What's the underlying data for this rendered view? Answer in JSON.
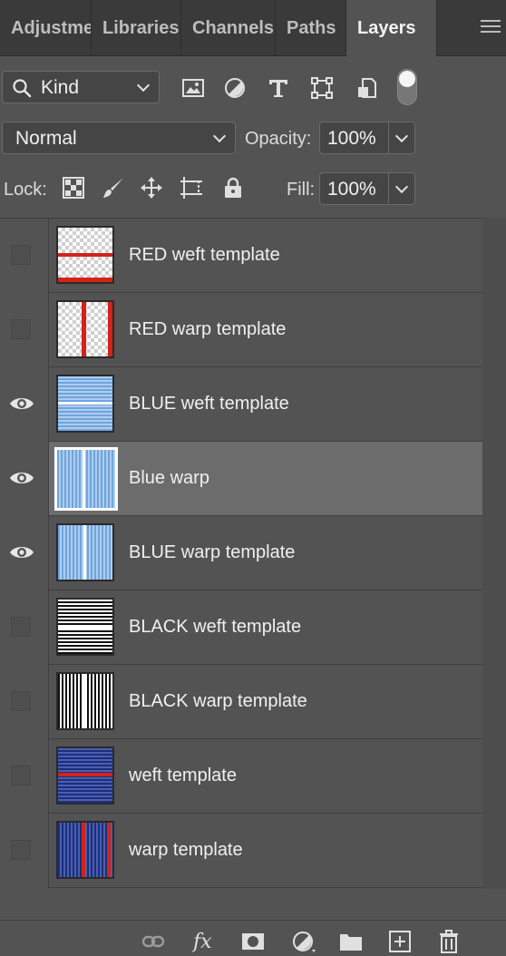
{
  "tabs": [
    {
      "label": "Adjustments",
      "active": false
    },
    {
      "label": "Libraries",
      "active": false
    },
    {
      "label": "Channels",
      "active": false
    },
    {
      "label": "Paths",
      "active": false
    },
    {
      "label": "Layers",
      "active": true
    }
  ],
  "filter": {
    "kind_label": "Kind",
    "icons": [
      "pixel-layer-filter-icon",
      "adjustment-layer-filter-icon",
      "type-layer-filter-icon",
      "shape-layer-filter-icon",
      "smart-object-filter-icon"
    ],
    "filter_toggle_on": false
  },
  "blend": {
    "mode": "Normal",
    "opacity_label": "Opacity:",
    "opacity_value": "100%"
  },
  "lock": {
    "label": "Lock:",
    "icons": [
      "lock-transparent-pixels-icon",
      "lock-image-pixels-icon",
      "lock-position-icon",
      "lock-artboard-icon",
      "lock-all-icon"
    ],
    "fill_label": "Fill:",
    "fill_value": "100%"
  },
  "layers": [
    {
      "name": "RED weft template",
      "visible": false,
      "thumb": "red-weft",
      "selected": false
    },
    {
      "name": "RED warp template",
      "visible": false,
      "thumb": "red-warp",
      "selected": false
    },
    {
      "name": "BLUE weft template",
      "visible": true,
      "thumb": "blue-weft",
      "selected": false
    },
    {
      "name": "Blue warp",
      "visible": true,
      "thumb": "blue-warp",
      "selected": true
    },
    {
      "name": "BLUE warp template",
      "visible": true,
      "thumb": "blue-warp",
      "selected": false
    },
    {
      "name": "BLACK weft template",
      "visible": false,
      "thumb": "black-weft",
      "selected": false
    },
    {
      "name": "BLACK warp template",
      "visible": false,
      "thumb": "black-warp",
      "selected": false
    },
    {
      "name": "weft template",
      "visible": false,
      "thumb": "navy-weft",
      "selected": false
    },
    {
      "name": "warp template",
      "visible": false,
      "thumb": "navy-warp",
      "selected": false
    }
  ],
  "bottom_icons": [
    "link-layers-icon",
    "fx-icon",
    "add-mask-icon",
    "new-adjustment-layer-icon",
    "new-group-icon",
    "new-layer-icon",
    "delete-layer-icon"
  ],
  "colors": {
    "panel": "#535353",
    "tabbar": "#3a3a3a",
    "selected_row": "#6c6c6c",
    "red_line": "#d2231a",
    "blue_fill": "#6fa4dc",
    "navy_fill": "#1d2f7a"
  }
}
